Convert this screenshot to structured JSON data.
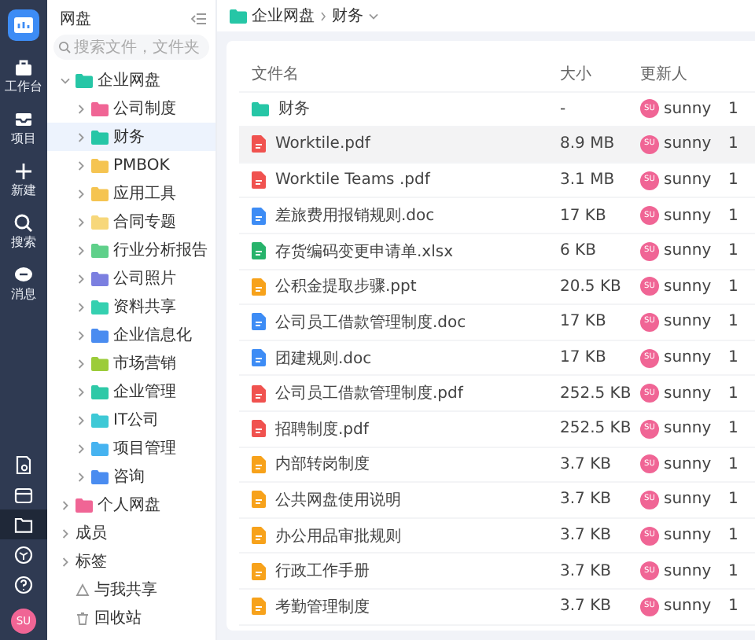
{
  "rail": {
    "top": [
      {
        "label": "工作台"
      },
      {
        "label": "项目"
      },
      {
        "label": "新建"
      },
      {
        "label": "搜索"
      },
      {
        "label": "消息"
      }
    ],
    "bottom": [
      {
        "selected": false
      },
      {
        "selected": false
      },
      {
        "selected": true
      },
      {
        "selected": false
      },
      {
        "selected": false
      }
    ],
    "avatar": "SU"
  },
  "sidebar": {
    "title": "网盘",
    "search": {
      "placeholder": "搜索文件，文件夹"
    },
    "tree": [
      {
        "kind": "folder",
        "label": "企业网盘",
        "color": "#26c6a6",
        "expanded": true,
        "selected": false,
        "children": [
          {
            "kind": "folder",
            "label": "公司制度",
            "color": "#f06595",
            "expanded": false,
            "selected": false
          },
          {
            "kind": "folder",
            "label": "财务",
            "color": "#26c6a6",
            "expanded": false,
            "selected": true
          },
          {
            "kind": "folder",
            "label": "PMBOK",
            "color": "#f5c451",
            "expanded": false,
            "selected": false
          },
          {
            "kind": "folder",
            "label": "应用工具",
            "color": "#f5c451",
            "expanded": false,
            "selected": false
          },
          {
            "kind": "folder",
            "label": "合同专题",
            "color": "#f7d77a",
            "expanded": false,
            "selected": false
          },
          {
            "kind": "folder",
            "label": "行业分析报告",
            "color": "#5fd08a",
            "expanded": false,
            "selected": false
          },
          {
            "kind": "folder",
            "label": "公司照片",
            "color": "#7b7fe0",
            "expanded": false,
            "selected": false
          },
          {
            "kind": "folder",
            "label": "资料共享",
            "color": "#35d0b0",
            "expanded": false,
            "selected": false
          },
          {
            "kind": "folder",
            "label": "企业信息化",
            "color": "#4a8cf0",
            "expanded": false,
            "selected": false
          },
          {
            "kind": "folder",
            "label": "市场营销",
            "color": "#9ccc3a",
            "expanded": false,
            "selected": false
          },
          {
            "kind": "folder",
            "label": "企业管理",
            "color": "#2ec9a7",
            "expanded": false,
            "selected": false
          },
          {
            "kind": "folder",
            "label": "IT公司",
            "color": "#3ec9d6",
            "expanded": false,
            "selected": false
          },
          {
            "kind": "folder",
            "label": "项目管理",
            "color": "#46b3f0",
            "expanded": false,
            "selected": false
          },
          {
            "kind": "folder",
            "label": "咨询",
            "color": "#4a8cf0",
            "expanded": false,
            "selected": false
          }
        ]
      },
      {
        "kind": "folder",
        "label": "个人网盘",
        "color": "#f06595",
        "expanded": false,
        "selected": false
      },
      {
        "kind": "group",
        "label": "成员",
        "expanded": false,
        "selected": false
      },
      {
        "kind": "group",
        "label": "标签",
        "expanded": false,
        "selected": false
      },
      {
        "kind": "shared",
        "label": "与我共享",
        "selected": false
      },
      {
        "kind": "trash",
        "label": "回收站",
        "selected": false
      }
    ]
  },
  "breadcrumb": {
    "items": [
      "企业网盘",
      "财务"
    ]
  },
  "table": {
    "columns": [
      "文件名",
      "大小",
      "更新人"
    ],
    "rows": [
      {
        "kind": "folder",
        "name": "财务",
        "size": "-",
        "avatar": "SU",
        "user": "sunny",
        "column_4": "1",
        "selected": false
      },
      {
        "kind": "pdf",
        "name": "Worktile.pdf",
        "size": "8.9 MB",
        "avatar": "SU",
        "user": "sunny",
        "column_4": "1",
        "selected": true
      },
      {
        "kind": "pdf",
        "name": "Worktile Teams .pdf",
        "size": "3.1 MB",
        "avatar": "SU",
        "user": "sunny",
        "column_4": "1",
        "selected": false
      },
      {
        "kind": "doc",
        "name": "差旅费用报销规则.doc",
        "size": "17 KB",
        "avatar": "SU",
        "user": "sunny",
        "column_4": "1",
        "selected": false
      },
      {
        "kind": "xlsx",
        "name": "存货编码变更申请单.xlsx",
        "size": "6 KB",
        "avatar": "SU",
        "user": "sunny",
        "column_4": "1",
        "selected": false
      },
      {
        "kind": "ppt",
        "name": "公积金提取步骤.ppt",
        "size": "20.5 KB",
        "avatar": "SU",
        "user": "sunny",
        "column_4": "1",
        "selected": false
      },
      {
        "kind": "doc",
        "name": "公司员工借款管理制度.doc",
        "size": "17 KB",
        "avatar": "SU",
        "user": "sunny",
        "column_4": "1",
        "selected": false
      },
      {
        "kind": "doc",
        "name": "团建规则.doc",
        "size": "17 KB",
        "avatar": "SU",
        "user": "sunny",
        "column_4": "1",
        "selected": false
      },
      {
        "kind": "pdf",
        "name": "公司员工借款管理制度.pdf",
        "size": "252.5 KB",
        "avatar": "SU",
        "user": "sunny",
        "column_4": "1",
        "selected": false
      },
      {
        "kind": "pdf",
        "name": "招聘制度.pdf",
        "size": "252.5 KB",
        "avatar": "SU",
        "user": "sunny",
        "column_4": "1",
        "selected": false
      },
      {
        "kind": "note",
        "name": "内部转岗制度",
        "size": "3.7 KB",
        "avatar": "SU",
        "user": "sunny",
        "column_4": "1",
        "selected": false
      },
      {
        "kind": "note",
        "name": "公共网盘使用说明",
        "size": "3.7 KB",
        "avatar": "SU",
        "user": "sunny",
        "column_4": "1",
        "selected": false
      },
      {
        "kind": "note",
        "name": "办公用品审批规则",
        "size": "3.7 KB",
        "avatar": "SU",
        "user": "sunny",
        "column_4": "1",
        "selected": false
      },
      {
        "kind": "note",
        "name": "行政工作手册",
        "size": "3.7 KB",
        "avatar": "SU",
        "user": "sunny",
        "column_4": "1",
        "selected": false
      },
      {
        "kind": "note",
        "name": "考勤管理制度",
        "size": "3.7 KB",
        "avatar": "SU",
        "user": "sunny",
        "column_4": "1",
        "selected": false
      }
    ]
  }
}
